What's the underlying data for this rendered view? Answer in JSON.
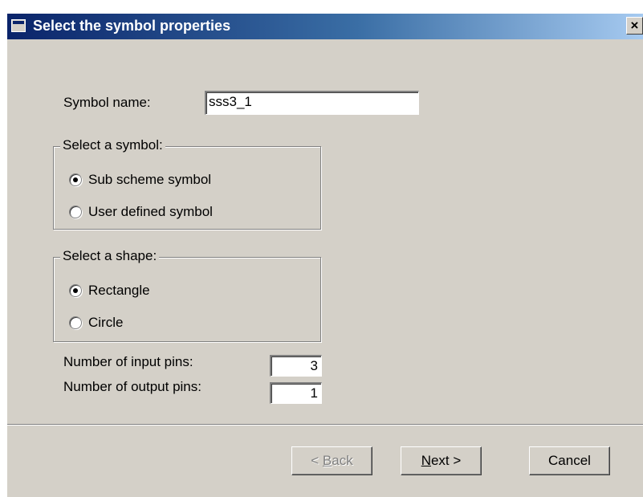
{
  "window": {
    "title": "Select the symbol properties",
    "close_label": "×"
  },
  "symbol_name": {
    "label": "Symbol name:",
    "value": "sss3_1"
  },
  "symbol_group": {
    "legend": "Select a symbol:",
    "options": [
      {
        "label": "Sub scheme symbol",
        "checked": true
      },
      {
        "label": "User defined symbol",
        "checked": false
      }
    ]
  },
  "shape_group": {
    "legend": "Select a shape:",
    "options": [
      {
        "label": "Rectangle",
        "checked": true
      },
      {
        "label": "Circle",
        "checked": false
      }
    ]
  },
  "input_pins": {
    "label": "Number of input pins:",
    "value": "3"
  },
  "output_pins": {
    "label": "Number of output pins:",
    "value": "1"
  },
  "buttons": {
    "back": {
      "prefix": "< ",
      "accel": "B",
      "rest": "ack",
      "enabled": false
    },
    "next": {
      "prefix": "",
      "accel": "N",
      "rest": "ext >",
      "enabled": true
    },
    "cancel": {
      "label": "Cancel",
      "enabled": true
    }
  }
}
